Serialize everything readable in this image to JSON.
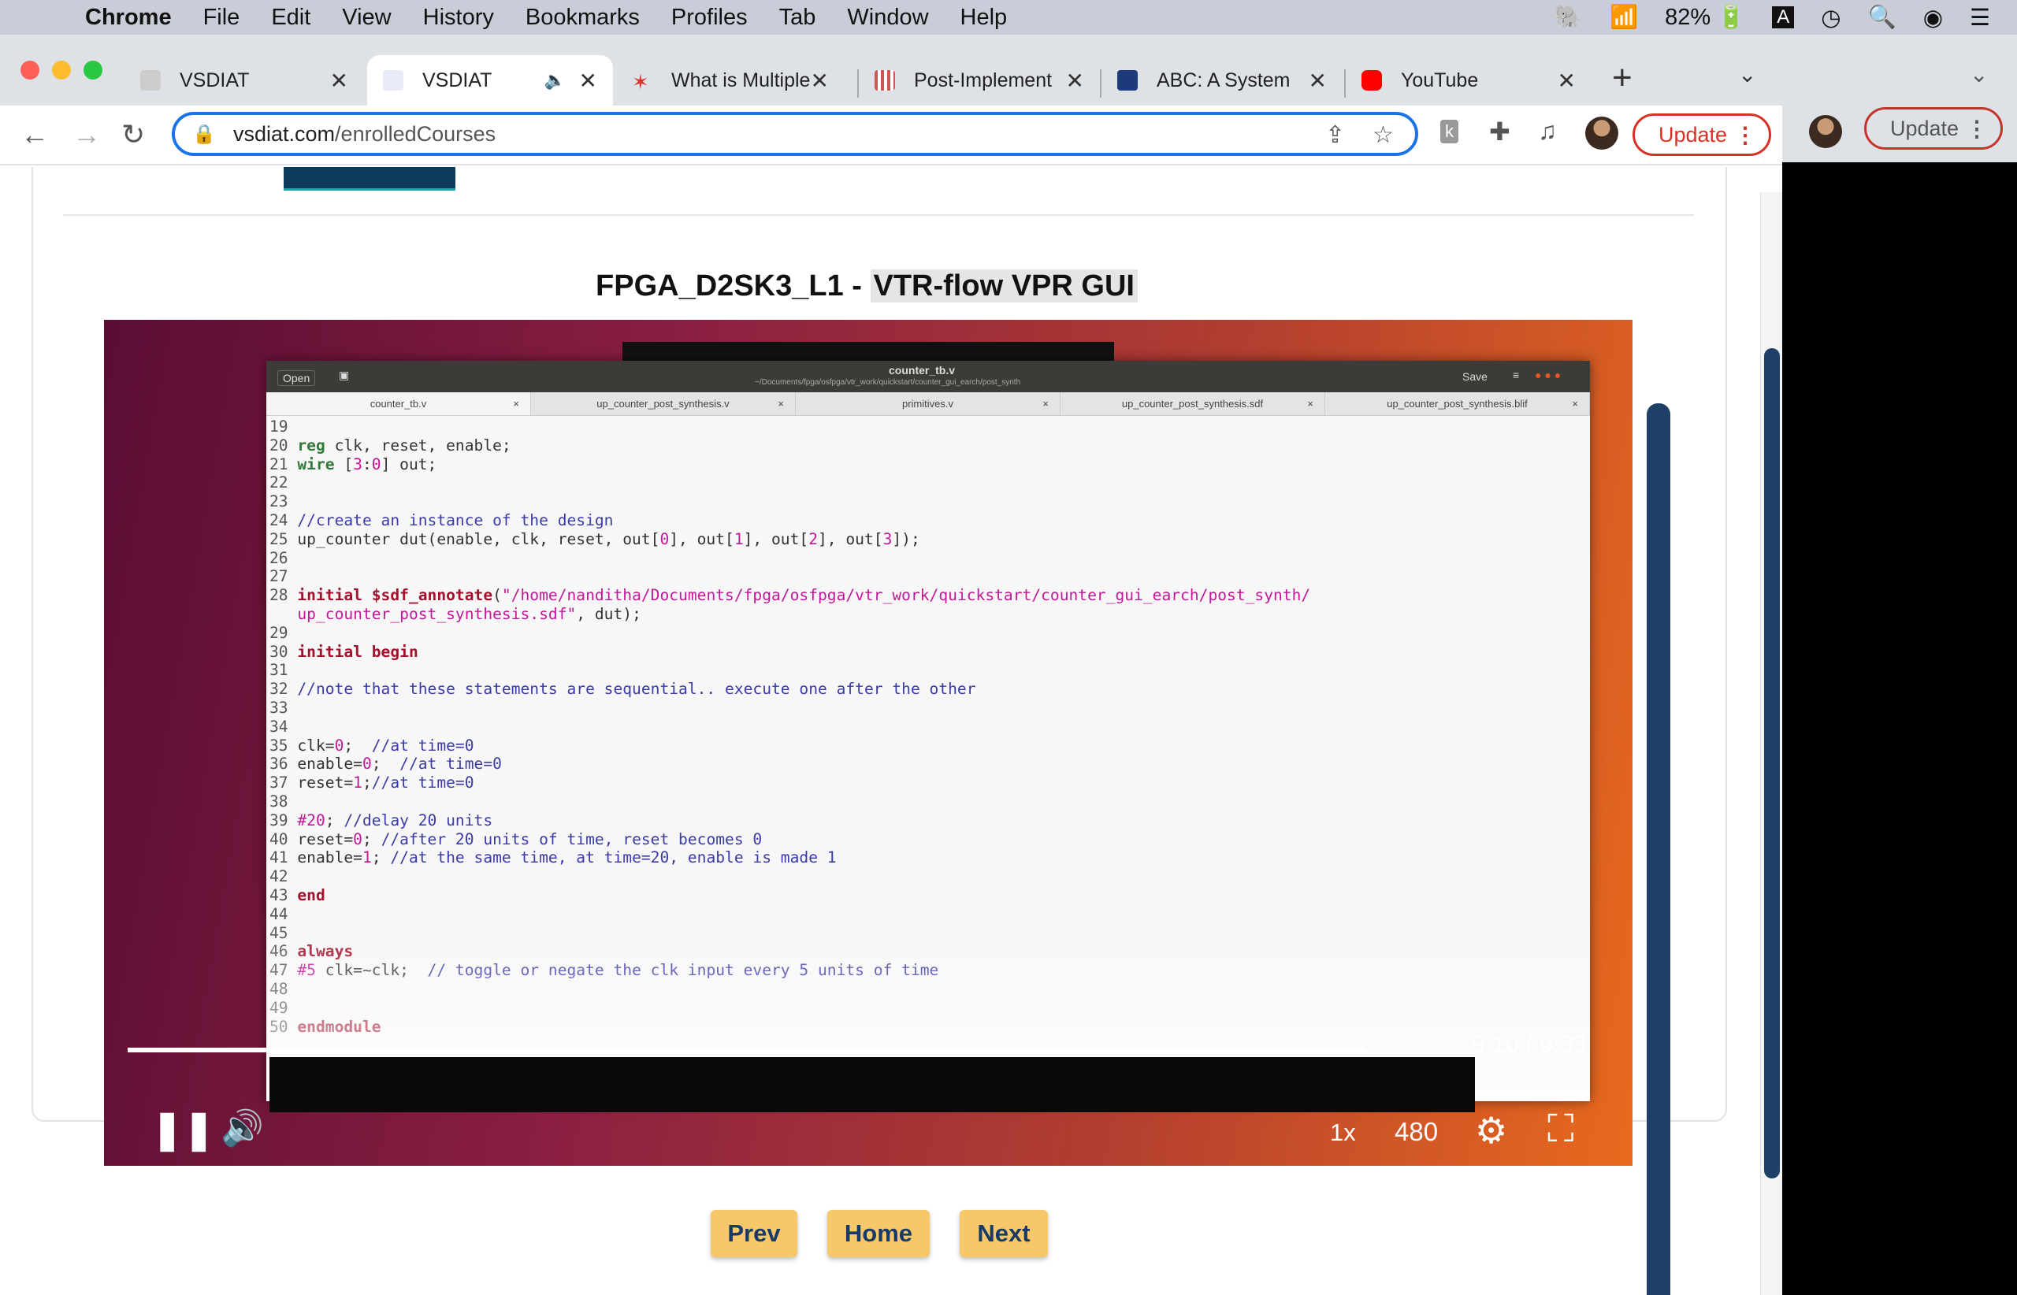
{
  "menubar": {
    "app": "Chrome",
    "items": [
      "File",
      "Edit",
      "View",
      "History",
      "Bookmarks",
      "Profiles",
      "Tab",
      "Window",
      "Help"
    ],
    "battery": "82%"
  },
  "tabs": [
    {
      "title": "VSDIAT",
      "active": false
    },
    {
      "title": "VSDIAT",
      "active": true
    },
    {
      "title": "What is Multiple",
      "active": false
    },
    {
      "title": "Post-Implement",
      "active": false
    },
    {
      "title": "ABC: A System f",
      "active": false
    },
    {
      "title": "YouTube",
      "active": false
    }
  ],
  "toolbar": {
    "url_domain": "vsdiat.com",
    "url_path": "/enrolledCourses",
    "update_label": "Update",
    "update_label_2": "Update"
  },
  "video": {
    "title_plain": "FPGA_D2SK3_L1 - ",
    "title_highlight": "VTR-flow VPR GUI",
    "time": "9:10 / 9:33",
    "progress": 0.96,
    "speed": "1x",
    "quality": "480"
  },
  "editor": {
    "title": "counter_tb.v",
    "subtitle": "~/Documents/fpga/osfpga/vtr_work/quickstart/counter_gui_earch/post_synth",
    "open_label": "Open",
    "save_label": "Save",
    "tabs": [
      "counter_tb.v",
      "up_counter_post_synthesis.v",
      "primitives.v",
      "up_counter_post_synthesis.sdf",
      "up_counter_post_synthesis.blif"
    ]
  },
  "nav": {
    "prev": "Prev",
    "home": "Home",
    "next": "Next"
  }
}
